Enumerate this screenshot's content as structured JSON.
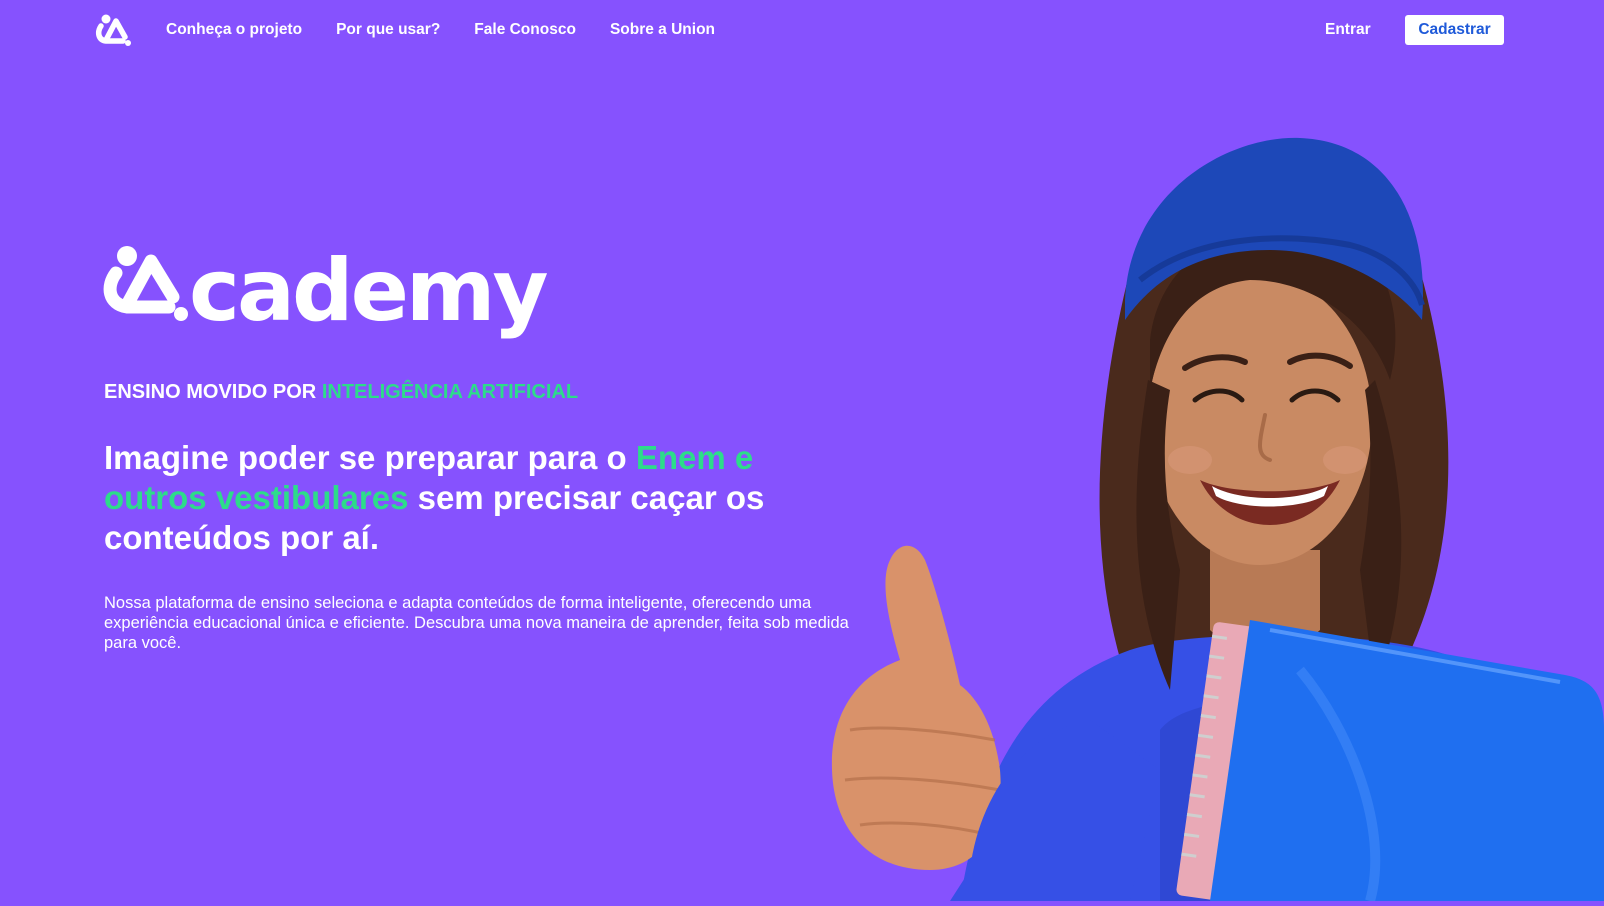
{
  "nav": {
    "links": [
      {
        "label": "Conheça o projeto"
      },
      {
        "label": "Por que usar?"
      },
      {
        "label": "Fale Conosco"
      },
      {
        "label": "Sobre a Union"
      }
    ],
    "login_label": "Entrar",
    "signup_label": "Cadastrar"
  },
  "hero": {
    "brand_word": "cademy",
    "tagline_prefix": "ENSINO MOVIDO POR ",
    "tagline_accent": "INTELIGÊNCIA ARTIFICIAL",
    "headline_part1": "Imagine poder se preparar para o ",
    "headline_accent": "Enem e outros vestibulares",
    "headline_part2": " sem precisar caçar os conteúdos por aí.",
    "description": "Nossa plataforma de ensino seleciona e adapta conteúdos de forma inteligente, oferecendo uma experiência educacional única e eficiente. Descubra uma nova maneira de aprender, feita sob medida para você."
  },
  "colors": {
    "background": "#8652fe",
    "accent_green": "#2ddc8a",
    "button_text": "#1f5ad9",
    "text": "#ffffff"
  },
  "icons": {
    "nav_logo": "academy-logo-icon",
    "brand_mark": "academy-a-mark-icon"
  }
}
